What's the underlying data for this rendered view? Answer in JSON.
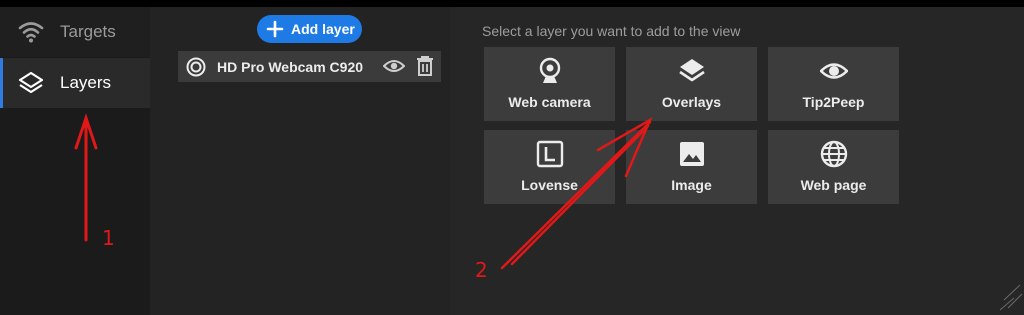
{
  "sidebar": {
    "items": [
      {
        "label": "Targets",
        "icon": "wifi-icon"
      },
      {
        "label": "Layers",
        "icon": "layers-icon"
      }
    ]
  },
  "layers": {
    "add_label": "Add layer",
    "items": [
      {
        "name": "HD Pro Webcam C920",
        "icon": "webcam-target-icon"
      }
    ]
  },
  "picker": {
    "hint": "Select a layer you want to add to the view",
    "tiles": [
      {
        "label": "Web camera",
        "icon": "webcam-icon"
      },
      {
        "label": "Overlays",
        "icon": "layers-icon"
      },
      {
        "label": "Tip2Peep",
        "icon": "eye-icon"
      },
      {
        "label": "Lovense",
        "icon": "lovense-icon"
      },
      {
        "label": "Image",
        "icon": "image-icon"
      },
      {
        "label": "Web page",
        "icon": "globe-icon"
      }
    ]
  },
  "annotations": {
    "marker_1": "1",
    "marker_2": "2"
  },
  "colors": {
    "accent": "#1e7ae4",
    "annotation": "#e01818"
  }
}
